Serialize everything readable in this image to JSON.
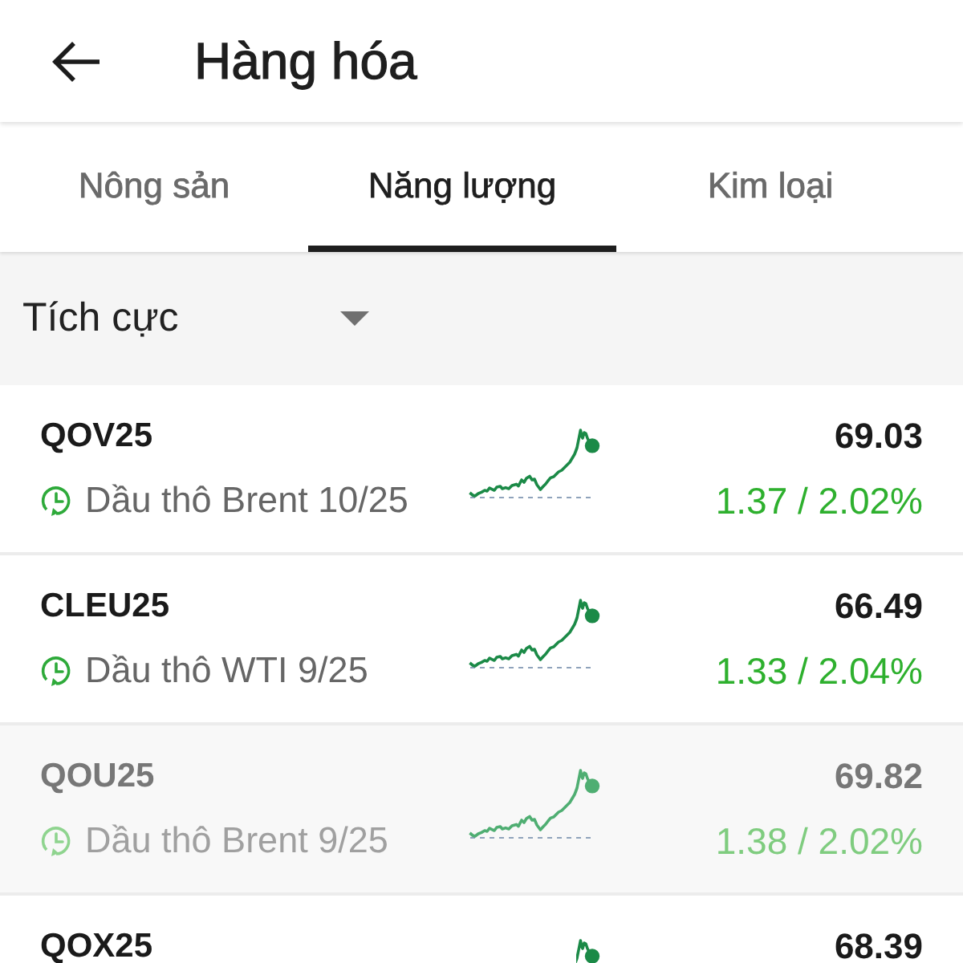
{
  "header": {
    "title": "Hàng hóa"
  },
  "tabs": [
    {
      "label": "Nông sản",
      "selected": false
    },
    {
      "label": "Năng lượng",
      "selected": true
    },
    {
      "label": "Kim loại",
      "selected": false
    }
  ],
  "filter": {
    "label": "Tích cực"
  },
  "rows": [
    {
      "symbol": "QOV25",
      "name": "Dầu thô Brent 10/25",
      "price": "69.03",
      "change": "1.37 / 2.02%",
      "dimmed": false
    },
    {
      "symbol": "CLEU25",
      "name": "Dầu thô WTI 9/25",
      "price": "66.49",
      "change": "1.33 / 2.04%",
      "dimmed": false
    },
    {
      "symbol": "QOU25",
      "name": "Dầu thô Brent 9/25",
      "price": "69.82",
      "change": "1.38 / 2.02%",
      "dimmed": true
    },
    {
      "symbol": "QOX25",
      "price": "68.39",
      "dimmed": false
    }
  ]
}
